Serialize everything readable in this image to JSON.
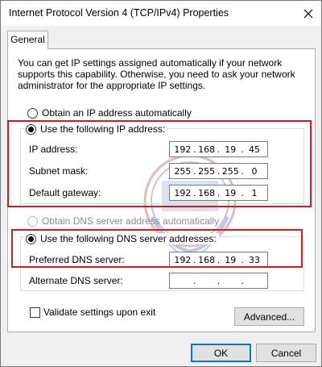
{
  "window": {
    "title": "Internet Protocol Version 4 (TCP/IPv4) Properties",
    "close_glyph": "✕"
  },
  "tabs": [
    {
      "label": "General",
      "selected": true
    }
  ],
  "description": "You can get IP settings assigned automatically if your network supports this capability. Otherwise, you need to ask your network administrator for the appropriate IP settings.",
  "ip_section": {
    "auto_option": {
      "label": "Obtain an IP address automatically",
      "checked": false
    },
    "manual_option": {
      "label": "Use the following IP address:",
      "checked": true
    },
    "fields": [
      {
        "label": "IP address:",
        "octets": [
          "192",
          "168",
          "19",
          "45"
        ]
      },
      {
        "label": "Subnet mask:",
        "octets": [
          "255",
          "255",
          "255",
          "0"
        ]
      },
      {
        "label": "Default gateway:",
        "octets": [
          "192",
          "168",
          "19",
          "1"
        ]
      }
    ]
  },
  "dns_section": {
    "auto_option": {
      "label": "Obtain DNS server address automatically",
      "checked": false,
      "disabled": true
    },
    "manual_option": {
      "label": "Use the following DNS server addresses:",
      "checked": true
    },
    "fields": [
      {
        "label": "Preferred DNS server:",
        "octets": [
          "192",
          "168",
          "19",
          "33"
        ]
      },
      {
        "label": "Alternate DNS server:",
        "octets": [
          "",
          "",
          "",
          ""
        ]
      }
    ]
  },
  "validate_checkbox": {
    "label": "Validate settings upon exit",
    "checked": false
  },
  "buttons": {
    "advanced": "Advanced...",
    "ok": "OK",
    "cancel": "Cancel"
  },
  "colors": {
    "highlight_frame": "#d9191c",
    "primary_border": "#0078d7"
  }
}
